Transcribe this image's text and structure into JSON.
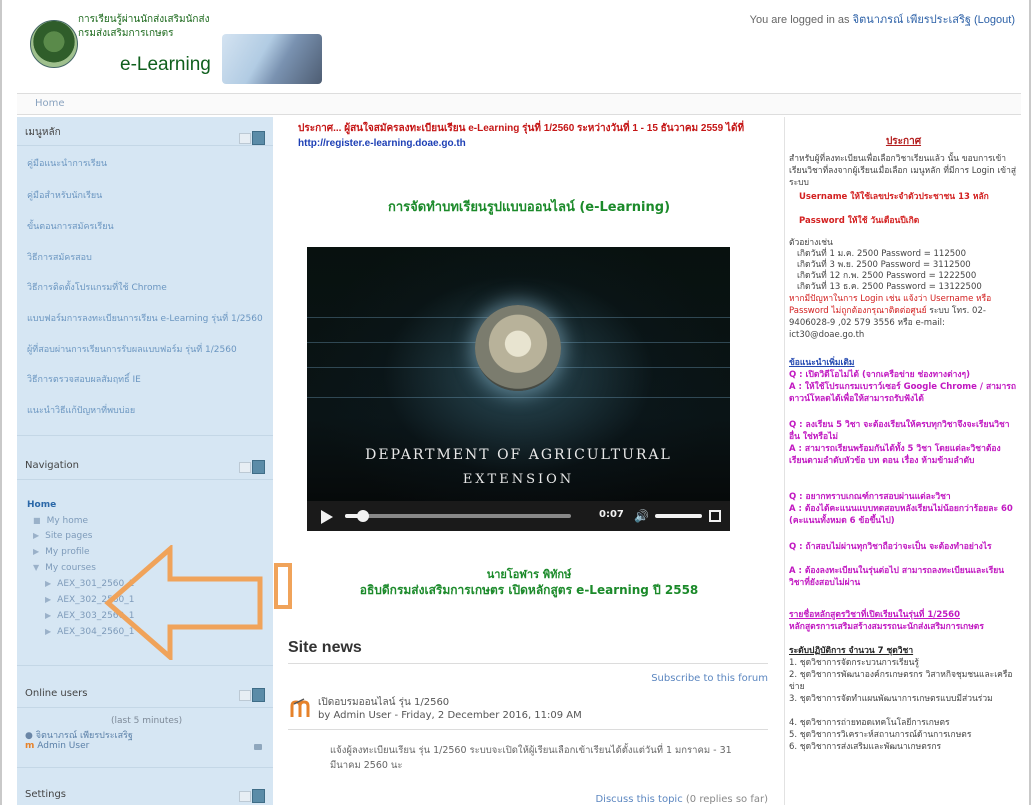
{
  "header": {
    "logo_line1": "การเรียนรู้ผ่านนักส่งเสริมนักส่ง",
    "logo_line2": "กรมส่งเสริมการเกษตร",
    "logo_title": "e-Learning",
    "logged_prefix": "You are logged in as",
    "logged_user": "จิตนาภรณ์ เพียรประเสริฐ",
    "logout_label": "(Logout)"
  },
  "breadcrumb": {
    "home": "Home"
  },
  "main_menu": {
    "title": "เมนูหลัก",
    "items": [
      "คู่มือแนะนำการเรียน",
      "คู่มือสำหรับนักเรียน",
      "ขั้นตอนการสมัครเรียน",
      "วิธีการสมัครสอบ",
      "วิธีการติดตั้งโปรแกรมที่ใช้ Chrome",
      "แบบฟอร์มการลงทะเบียนการเรียน e-Learning รุ่นที่ 1/2560",
      "ผู้ที่สอบผ่านการเรียนการรับผลแบบฟอร์ม รุ่นที่ 1/2560",
      "วิธีการตรวจสอบผลสัมฤทธิ์ IE",
      "แนะนำวิธีแก้ปัญหาที่พบบ่อย"
    ]
  },
  "navigation": {
    "title": "Navigation",
    "home": "Home",
    "items": [
      "My home",
      "Site pages",
      "My profile",
      "My courses"
    ],
    "courses": [
      "AEX_301_2560_1",
      "AEX_302_2560_1",
      "AEX_303_2560_1",
      "AEX_304_2560_1"
    ]
  },
  "online_users": {
    "title": "Online users",
    "window": "(last 5 minutes)",
    "users": [
      "จิตนาภรณ์ เพียรประเสริฐ",
      "Admin User"
    ]
  },
  "settings": {
    "title": "Settings"
  },
  "center": {
    "announce_red": "ประกาศ... ผู้สนใจสมัครลงทะเบียนเรียน e-Learning รุ่นที่ 1/2560 ระหว่างวันที่ 1 - 15 ธันวาคม 2559 ได้ที่",
    "announce_url": "http://register.e-learning.doae.go.th",
    "course_title": "การจัดทำบทเรียนรูปแบบออนไลน์ (e-Learning)",
    "video": {
      "dept_line1": "DEPARTMENT OF AGRICULTURAL",
      "dept_line2": "EXTENSION",
      "time": "0:07",
      "progress_fraction": 0.08,
      "volume_fraction": 1.0
    },
    "presenter": "นายโอฬาร พิทักษ์",
    "tagline": "อธิบดีกรมส่งเสริมการเกษตร เปิดหลักสูตร e-Learning ปี 2558",
    "site_news": {
      "title": "Site news",
      "subscribe": "Subscribe to this forum",
      "post_title": "เปิดอบรมออนไลน์ รุ่น 1/2560",
      "post_by": "by Admin User - Friday, 2 December 2016, 11:09 AM",
      "post_body": "แจ้งผู้ลงทะเบียนเรียน รุ่น 1/2560 ระบบจะเปิดให้ผู้เรียนเลือกเข้าเรียนได้ตั้งแต่วันที่ 1 มกราคม - 31 มีนาคม 2560 นะ",
      "discuss": "Discuss this topic",
      "replies": "(0 replies so far)"
    }
  },
  "right": {
    "title": "ประกาศ",
    "intro": "สำหรับผู้ที่ลงทะเบียนเพื่อเลือกวิชาเรียนแล้ว นั้น ขอบการเข้าเรียนวิชาที่ลงจากผู้เรียนเมื่อเลือก เมนูหลัก ที่มีการ Login เข้าสู่ระบบ",
    "bullet1": "Username ให้ใช้เลขประจำตัวประชาชน 13 หลัก",
    "bullet2": "Password ให้ใช้ วันเดือนปีเกิด",
    "example_head": "ตัวอย่างเช่น",
    "examples": [
      "เกิดวันที่ 1 ม.ค. 2500  Password = 112500",
      "เกิดวันที่ 3 พ.ย. 2500  Password = 3112500",
      "เกิดวันที่ 12 ก.พ. 2500  Password = 1222500",
      "เกิดวันที่ 13 ธ.ค. 2500  Password = 13122500"
    ],
    "contact_red": "หากมีปัญหาในการ Login เช่น แจ้งว่า Username หรือ Password ไม่ถูกต้องกรุณาติดต่อศูนย์",
    "contact": "ระบบ โทร. 02-9406028-9 ,02 579 3556 หรือ e-mail: ict30@doae.go.th",
    "faq_head": "ข้อแนะนำเพิ่มเติม",
    "faq": [
      "Q : เปิดวิดีโอไม่ได้ (จากเครือข่าย ช่องทางต่างๆ)",
      "A : ให้ใช้โปรแกรมเบราว์เซอร์ Google Chrome / สามารถดาวน์โหลดได้เพื่อให้สามารถรับฟังได้",
      "Q : ลงเรียน 5 วิชา จะต้องเรียนให้ครบทุกวิชาจึงจะเรียนวิชาอื่น ใช่หรือไม่",
      "A : สามารถเรียนพร้อมกันได้ทั้ง 5 วิชา โดยแต่ละวิชาต้องเรียนตามลำดับหัวข้อ บท ตอน เรื่อง ห้ามข้ามลำดับ",
      "Q : อยากทราบเกณฑ์การสอบผ่านแต่ละวิชา",
      "A : ต้องได้คะแนนแบบทดสอบหลังเรียนไม่น้อยกว่าร้อยละ 60 (คะแนนทั้งหมด 6 ข้อขึ้นไป)",
      "Q : ถ้าสอบไม่ผ่านทุกวิชาถือว่าจะเป็น จะต้องทำอย่างไร",
      "A : ต้องลงทะเบียนในรุ่นต่อไป สามารถลงทะเบียนและเรียนวิชาที่ยังสอบไม่ผ่าน"
    ],
    "list_head": "รายชื่อหลักสูตรวิชาที่เปิดเรียนในรุ่นที่ 1/2560",
    "list_sub": "หลักสูตรการเสริมสร้างสมรรถนะนักส่งเสริมการเกษตร",
    "list_level": "ระดับปฏิบัติการ จำนวน 7 ชุดวิชา",
    "list_items": [
      "1. ชุดวิชาการจัดกระบวนการเรียนรู้",
      "2. ชุดวิชาการพัฒนาองค์กรเกษตรกร วิสาหกิจชุมชนและเครือข่าย",
      "3. ชุดวิชาการจัดทำแผนพัฒนาการเกษตรแบบมีส่วนร่วม",
      "4. ชุดวิชาการถ่ายทอดเทคโนโลยีการเกษตร",
      "5. ชุดวิชาการวิเคราะห์สถานการณ์ด้านการเกษตร",
      "6. ชุดวิชาการส่งเสริมและพัฒนาเกษตรกร"
    ]
  },
  "colors": {
    "accent": "#2e62a8",
    "left_bg": "#d6e6f3",
    "arrow": "#f0a35a"
  }
}
